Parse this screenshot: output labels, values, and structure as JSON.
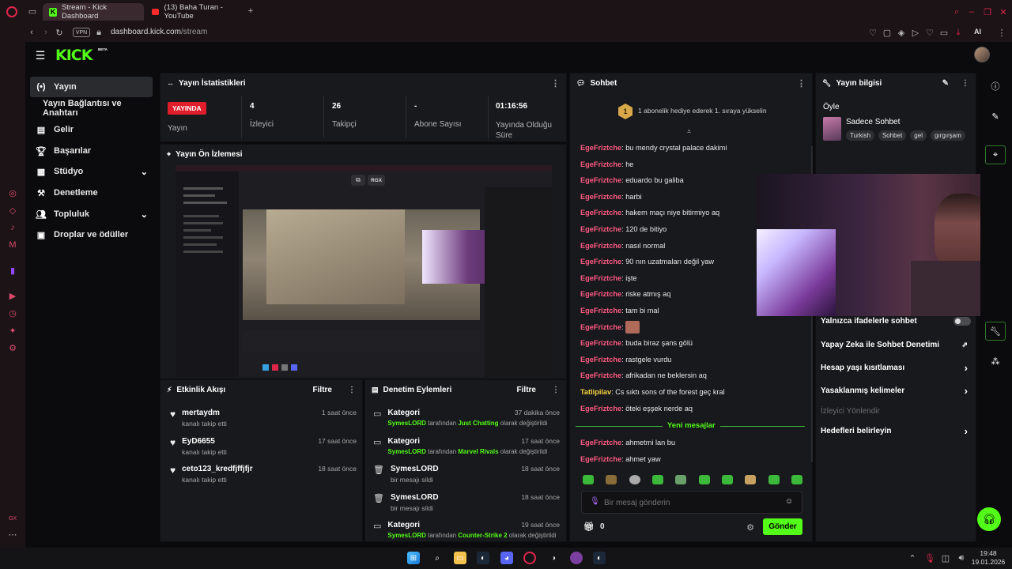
{
  "browser": {
    "tabs": [
      {
        "label": "Stream - Kick Dashboard",
        "active": true
      },
      {
        "label": "(13) Baha Turan - YouTube",
        "active": false
      }
    ],
    "vpn_label": "VPN",
    "url_domain": "dashboard.kick.com",
    "url_path": "/stream",
    "ai_label": "AI"
  },
  "brand": {
    "logo": "KICK",
    "beta": "BETA",
    "accent": "#53fc18"
  },
  "sidebar": {
    "items": [
      {
        "label": "Yayın",
        "icon": "broadcast-icon"
      },
      {
        "label": "Yayın Bağlantısı ve Anahtarı",
        "icon": ""
      },
      {
        "label": "Gelir",
        "icon": "revenue-icon"
      },
      {
        "label": "Başarılar",
        "icon": "trophy-icon"
      },
      {
        "label": "Stüdyo",
        "icon": "studio-icon"
      },
      {
        "label": "Denetleme",
        "icon": "moderation-icon"
      },
      {
        "label": "Topluluk",
        "icon": "community-icon"
      },
      {
        "label": "Droplar ve ödüller",
        "icon": "drops-icon"
      }
    ]
  },
  "stats": {
    "title": "Yayın İstatistikleri",
    "live_badge": "YAYINDA",
    "live_label": "Yayın",
    "viewers_value": "4",
    "viewers_label": "İzleyici",
    "followers_value": "26",
    "followers_label": "Takipçi",
    "subs_value": "-",
    "subs_label": "Abone Sayısı",
    "uptime_value": "01:16:56",
    "uptime_label": "Yayında Olduğu Süre"
  },
  "preview": {
    "title": "Yayın Ön İzlemesi",
    "badge": "RGX"
  },
  "activity": {
    "title": "Etkinlik Akışı",
    "filter": "Filtre",
    "items": [
      {
        "name": "mertaydm",
        "desc": "kanalı takip etti",
        "time": "1 saat önce"
      },
      {
        "name": "EyD6655",
        "desc": "kanalı takip etti",
        "time": "17 saat önce"
      },
      {
        "name": "ceto123_kredfjffjfjr",
        "desc": "kanalı takip etti",
        "time": "18 saat önce"
      }
    ]
  },
  "modlog": {
    "title": "Denetim Eylemleri",
    "filter": "Filtre",
    "by_word": "tarafından",
    "as_changed": "olarak değiştirildi",
    "items": [
      {
        "title": "Kategori",
        "user": "SymesLORD",
        "value": "Just Chatting",
        "time": "37 dakika önce",
        "type": "category"
      },
      {
        "title": "Kategori",
        "user": "SymesLORD",
        "value": "Marvel Rivals",
        "time": "17 saat önce",
        "type": "category"
      },
      {
        "title": "SymesLORD",
        "desc": "bir mesajı sildi",
        "time": "18 saat önce",
        "type": "delete"
      },
      {
        "title": "SymesLORD",
        "desc": "bir mesajı sildi",
        "time": "18 saat önce",
        "type": "delete"
      },
      {
        "title": "Kategori",
        "user": "SymesLORD",
        "value": "Counter-Strike 2",
        "time": "19 saat önce",
        "type": "category"
      }
    ]
  },
  "chat": {
    "title": "Sohbet",
    "pinned_rank": "1",
    "pinned_text": "1 abonelik hediye ederek 1. sıraya yükselin",
    "new_messages": "Yeni mesajlar",
    "messages": [
      {
        "user": "EgeFriztche",
        "text": "bu mendy crystal palace dakimi"
      },
      {
        "user": "EgeFriztche",
        "text": "he"
      },
      {
        "user": "EgeFriztche",
        "text": "eduardo bu galiba"
      },
      {
        "user": "EgeFriztche",
        "text": "harbi"
      },
      {
        "user": "EgeFriztche",
        "text": "hakem maçı niye bitirmiyo aq"
      },
      {
        "user": "EgeFriztche",
        "text": "120 de bitiyo"
      },
      {
        "user": "EgeFriztche",
        "text": "nasıl normal"
      },
      {
        "user": "EgeFriztche",
        "text": "90 nın uzatmaları değil yaw"
      },
      {
        "user": "EgeFriztche",
        "text": "işte"
      },
      {
        "user": "EgeFriztche",
        "text": "riske atmış aq"
      },
      {
        "user": "EgeFriztche",
        "text": "tam bi mal"
      },
      {
        "user": "EgeFriztche",
        "text": "",
        "emote": true
      },
      {
        "user": "EgeFriztche",
        "text": "buda biraz şans gölü"
      },
      {
        "user": "EgeFriztche",
        "text": "rastgele vurdu"
      },
      {
        "user": "EgeFriztche",
        "text": "afrikadan ne beklersin aq"
      },
      {
        "user": "Tatlipilav",
        "text": "Cs sıktı sons of the forest geç kral",
        "alt": true
      },
      {
        "user": "EgeFriztche",
        "text": "öteki eşşek nerde aq"
      }
    ],
    "new_msgs": [
      {
        "user": "EgeFriztche",
        "text": "ahmetmi lan bu"
      },
      {
        "user": "EgeFriztche",
        "text": "ahmet yaw"
      }
    ],
    "input_placeholder": "Bir mesaj gönderin",
    "points": "0",
    "send_label": "Gönder"
  },
  "streaminfo": {
    "title": "Yayın bilgisi",
    "stream_title": "Öyle",
    "category": "Sadece Sohbet",
    "tags": [
      "Turkish",
      "Sohbet",
      "gel",
      "gırgırşam"
    ],
    "options": [
      {
        "label": "Yalnızca ifadelerle sohbet",
        "kind": "toggle"
      },
      {
        "label": "Yapay Zeka ile Sohbet Denetimi",
        "kind": "external"
      },
      {
        "label": "Hesap yaşı kısıtlaması",
        "kind": "arrow"
      },
      {
        "label": "Yasaklanmış kelimeler",
        "kind": "arrow"
      },
      {
        "label": "İzleyici Yönlendir",
        "kind": "disabled"
      },
      {
        "label": "Hedefleri belirleyin",
        "kind": "arrow"
      }
    ]
  },
  "taskbar": {
    "time": "19:48",
    "date": "19.01.2026"
  }
}
